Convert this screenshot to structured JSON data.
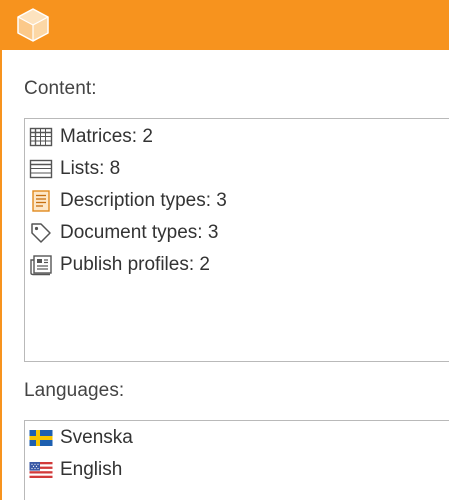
{
  "header": {
    "logo_icon": "cube-logo-icon",
    "color": "#f7931e"
  },
  "content": {
    "label": "Content:",
    "items": [
      {
        "icon": "matrix-grid-icon",
        "label": "Matrices: 2"
      },
      {
        "icon": "list-icon",
        "label": "Lists: 8"
      },
      {
        "icon": "description-type-icon",
        "label": "Description types: 3"
      },
      {
        "icon": "tag-icon",
        "label": "Document types: 3"
      },
      {
        "icon": "publish-profile-icon",
        "label": "Publish profiles: 2"
      }
    ]
  },
  "languages": {
    "label": "Languages:",
    "items": [
      {
        "icon": "swedish-flag-icon",
        "label": "Svenska"
      },
      {
        "icon": "us-flag-icon",
        "label": "English"
      }
    ]
  }
}
